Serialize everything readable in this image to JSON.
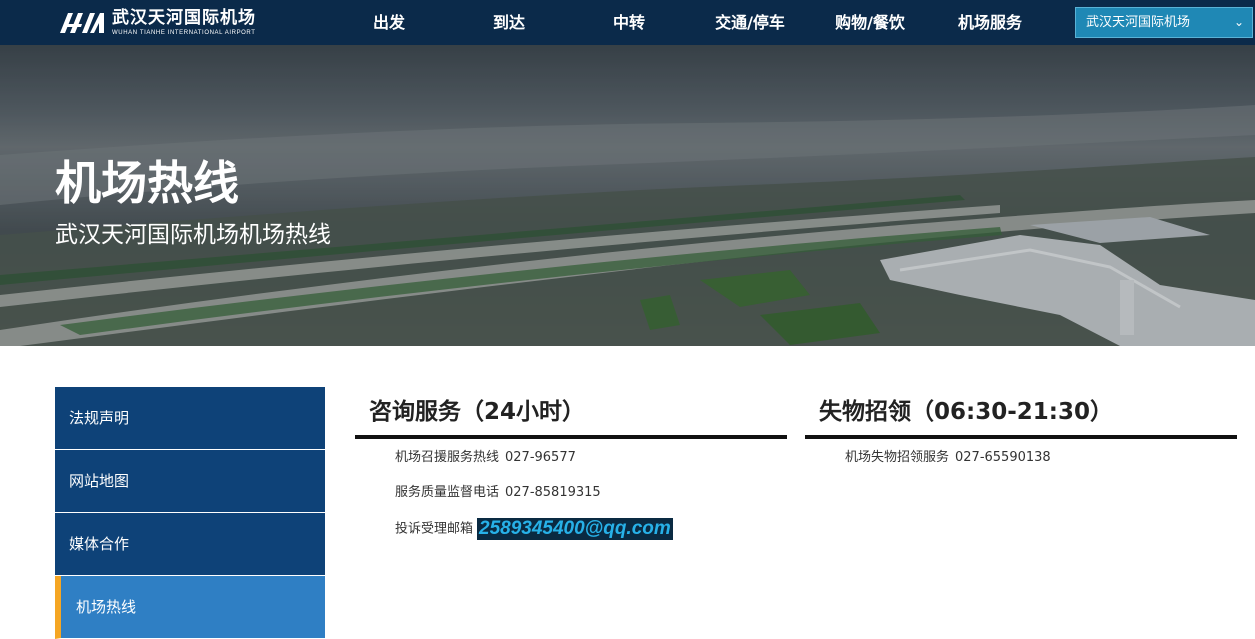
{
  "header": {
    "logo_cn": "武汉天河国际机场",
    "logo_en": "WUHAN TIANHE INTERNATIONAL AIRPORT",
    "logo_mark": "WHA",
    "nav": [
      "出发",
      "到达",
      "中转",
      "交通/停车",
      "购物/餐饮",
      "机场服务"
    ],
    "airport_select": "武汉天河国际机场"
  },
  "banner": {
    "title": "机场热线",
    "subtitle": "武汉天河国际机场机场热线"
  },
  "sidebar": {
    "items": [
      {
        "label": "法规声明"
      },
      {
        "label": "网站地图"
      },
      {
        "label": "媒体合作"
      },
      {
        "label": "机场热线"
      }
    ]
  },
  "panels": {
    "consult": {
      "title": "咨询服务（24小时）",
      "rows": [
        {
          "label": "机场召援服务热线",
          "value": "027-96577"
        },
        {
          "label": "服务质量监督电话",
          "value": "027-85819315"
        },
        {
          "label": "投诉受理邮箱",
          "value": "2589345400@qq.com"
        }
      ]
    },
    "lost": {
      "title": "失物招领（06:30-21:30）",
      "rows": [
        {
          "label": "机场失物招领服务",
          "value": "027-65590138"
        }
      ]
    }
  },
  "colors": {
    "topbar": "#0b2a4a",
    "sidebar": "#0e4278",
    "sidebar_active": "#2f7fc4",
    "active_marker": "#f5a623",
    "select": "#1f88b5"
  }
}
